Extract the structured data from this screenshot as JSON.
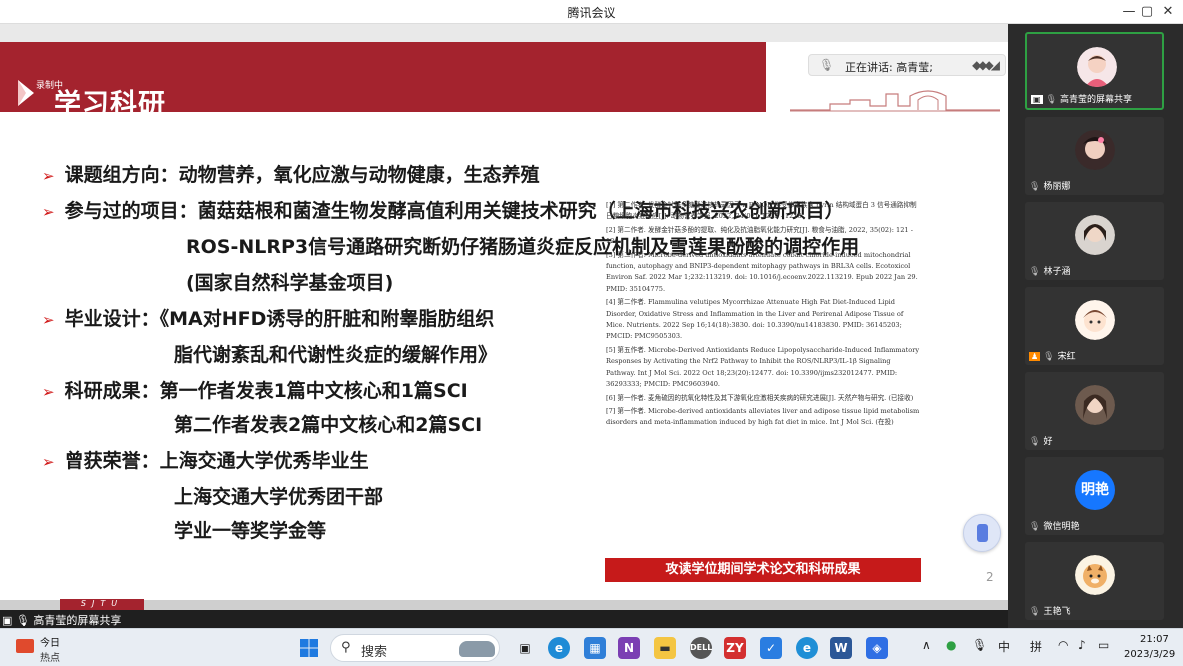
{
  "window": {
    "title": "腾讯会议"
  },
  "banner": {
    "rec_label": "录制中",
    "title": "学习科研",
    "speaking_label": "正在讲话: 高青莹;"
  },
  "slide": {
    "bullets": [
      {
        "text": "课题组方向：动物营养，氧化应激与动物健康，生态养殖"
      },
      {
        "text": "参与过的项目：菌菇菇根和菌渣生物发酵高值利用关键技术研究（上海市科技兴农创新项目）"
      },
      {
        "text": "毕业设计：《MA对HFD诱导的肝脏和附睾脂肪组织"
      },
      {
        "text": "科研成果：第一作者发表1篇中文核心和1篇SCI"
      },
      {
        "text": "曾获荣誉：上海交通大学优秀毕业生"
      }
    ],
    "continuations": [
      "ROS-NLRP3信号通路研究断奶仔猪肠道炎症反应机制及雪莲果酚酸的调控作用",
      "(国家自然科学基金项目)",
      "脂代谢紊乱和代谢性炎症的缓解作用》",
      "第二作者发表2篇中文核心和2篇SCI",
      "上海交通大学优秀团干部",
      "学业一等奖学金等"
    ],
    "references": [
      "[1] 第二作者. 发酵金针菇多糖通过核转录因子-κ B-NOD 样受体家族含 pyrin 结构域蛋白 3 信号通路抑制日粮细胞炎症反应[J]. 动物营养学报, 2022, 34(02): 1205 - 1216.",
      "[2] 第二作者. 发酵金针菇多酚的提取、纯化及抗油脂氧化能力研究[J]. 粮食与油脂, 2022, 35(02): 121 - 126.",
      "[3] 第二作者. Microbe-derived antioxidants attenuate cobalt chloride-induced mitochondrial function, autophagy and BNIP3-dependent mitophagy pathways in BRL3A cells. Ecotoxicol Environ Saf. 2022 Mar 1;232:113219. doi: 10.1016/j.ecoenv.2022.113219. Epub 2022 Jan 29. PMID: 35104775.",
      "[4] 第二作者. Flammulina velutipes Mycorrhizae Attenuate High Fat Diet-Induced Lipid Disorder, Oxidative Stress and Inflammation in the Liver and Perirenal Adipose Tissue of Mice. Nutrients. 2022 Sep 16;14(18):3830. doi: 10.3390/nu14183830. PMID: 36145203; PMCID: PMC9505303.",
      "[5] 第五作者. Microbe-Derived Antioxidants Reduce Lipopolysaccharide-Induced Inflammatory Responses by Activating the Nrf2 Pathway to Inhibit the ROS/NLRP3/IL-1β Signaling Pathway. Int J Mol Sci. 2022 Oct 18;23(20):12477. doi: 10.3390/ijms232012477. PMID: 36293333; PMCID: PMC9603940.",
      "[6] 第一作者. 麦角硫因的抗氧化特性及其下游氧化应激相关疾病的研究进展[J]. 天然产物与研究. (已接收)",
      "[7] 第一作者. Microbe-derived antioxidants alleviates liver and adipose tissue lipid metabolism disorders and meta-inflammation induced by high fat diet in mice. Int J Mol Sci. (在投)"
    ],
    "ref_caption": "攻读学位期间学术论文和科研成果",
    "page_number": "2",
    "footer_brand": "SJTU"
  },
  "share_label": "高青莹的屏幕共享",
  "participants": [
    {
      "name": "高青莹的屏幕共享",
      "sharing": true,
      "active": true
    },
    {
      "name": "杨丽娜"
    },
    {
      "name": "林子涵"
    },
    {
      "name": "宋红",
      "host": true
    },
    {
      "name": "好"
    },
    {
      "name": "微信明艳",
      "avatar_text": "明艳",
      "avatar_color": "#1677ff"
    },
    {
      "name": "王艳飞"
    }
  ],
  "taskbar": {
    "news_title": "今日",
    "news_sub": "热点",
    "search_placeholder": "搜索",
    "tray": {
      "ime_lang": "中",
      "ime_mode": "拼"
    },
    "clock_time": "21:07",
    "clock_date": "2023/3/29"
  },
  "icons": [
    "mic-icon",
    "search-icon",
    "windows-start-icon",
    "share-screen-icon",
    "minimize-icon",
    "maximize-icon",
    "close-icon",
    "sound-icon",
    "wifi-icon",
    "battery-icon"
  ]
}
